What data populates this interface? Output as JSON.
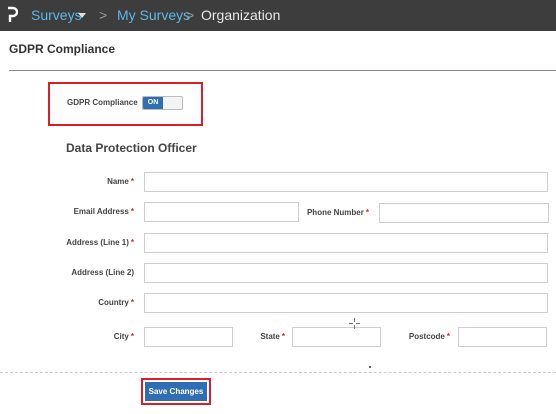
{
  "topbar": {
    "logo_icon": "product-logo-icon",
    "crumbs": [
      {
        "label": "Surveys"
      },
      {
        "label": "My Surveys"
      },
      {
        "label": "Organization"
      }
    ],
    "separator": ">"
  },
  "page": {
    "title": "GDPR Compliance"
  },
  "gdpr": {
    "label": "GDPR Compliance",
    "toggle_label": "ON",
    "toggle_state": "on"
  },
  "dpo": {
    "section_title": "Data Protection Officer",
    "required_mark": "*",
    "fields": {
      "name": {
        "label": "Name",
        "value": ""
      },
      "email": {
        "label": "Email Address",
        "value": ""
      },
      "phone": {
        "label": "Phone Number",
        "value": ""
      },
      "address1": {
        "label": "Address (Line 1)",
        "value": ""
      },
      "address2": {
        "label": "Address (Line 2)",
        "value": ""
      },
      "country": {
        "label": "Country",
        "value": ""
      },
      "city": {
        "label": "City",
        "value": ""
      },
      "state": {
        "label": "State",
        "value": ""
      },
      "postcode": {
        "label": "Postcode",
        "value": ""
      }
    }
  },
  "actions": {
    "save_label": "Save Changes"
  },
  "colors": {
    "topbar_bg": "#3d3d3d",
    "link": "#5eb6e8",
    "primary": "#2f6eb3",
    "required": "#d9202a",
    "highlight": "#d9202a"
  }
}
